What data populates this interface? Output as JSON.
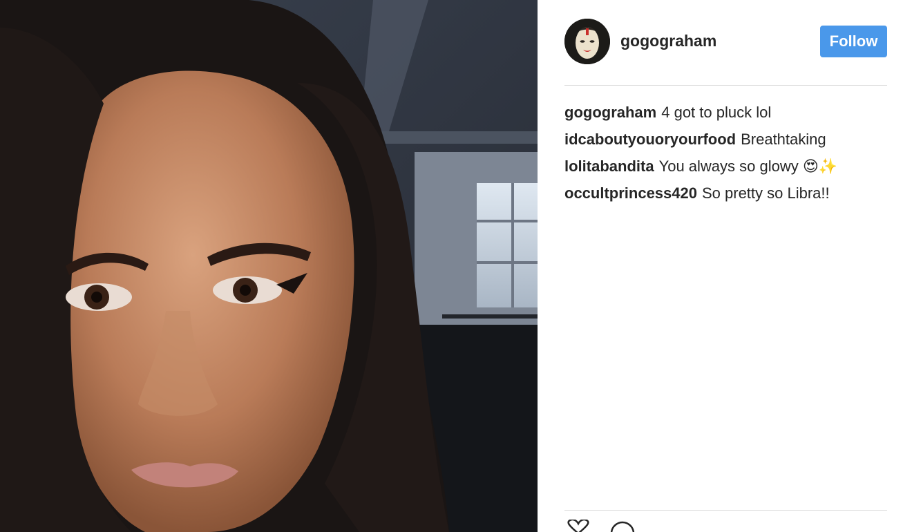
{
  "post": {
    "photo_icon": "selfie-photo",
    "avatar_icon": "mask-avatar-icon",
    "username": "gogograham",
    "follow_label": "Follow"
  },
  "comments": [
    {
      "user": "gogograham",
      "text": "4 got to pluck lol"
    },
    {
      "user": "idcaboutyouoryourfood",
      "text": "Breathtaking"
    },
    {
      "user": "lolitabandita",
      "text": "You always so glowy 😍✨"
    },
    {
      "user": "occultprincess420",
      "text": "So pretty so Libra!!"
    }
  ],
  "actions": {
    "like_icon": "heart-icon",
    "comment_icon": "comment-bubble-icon"
  },
  "colors": {
    "accent": "#4a98ea",
    "divider": "#dbdbdb",
    "text": "#262626"
  }
}
